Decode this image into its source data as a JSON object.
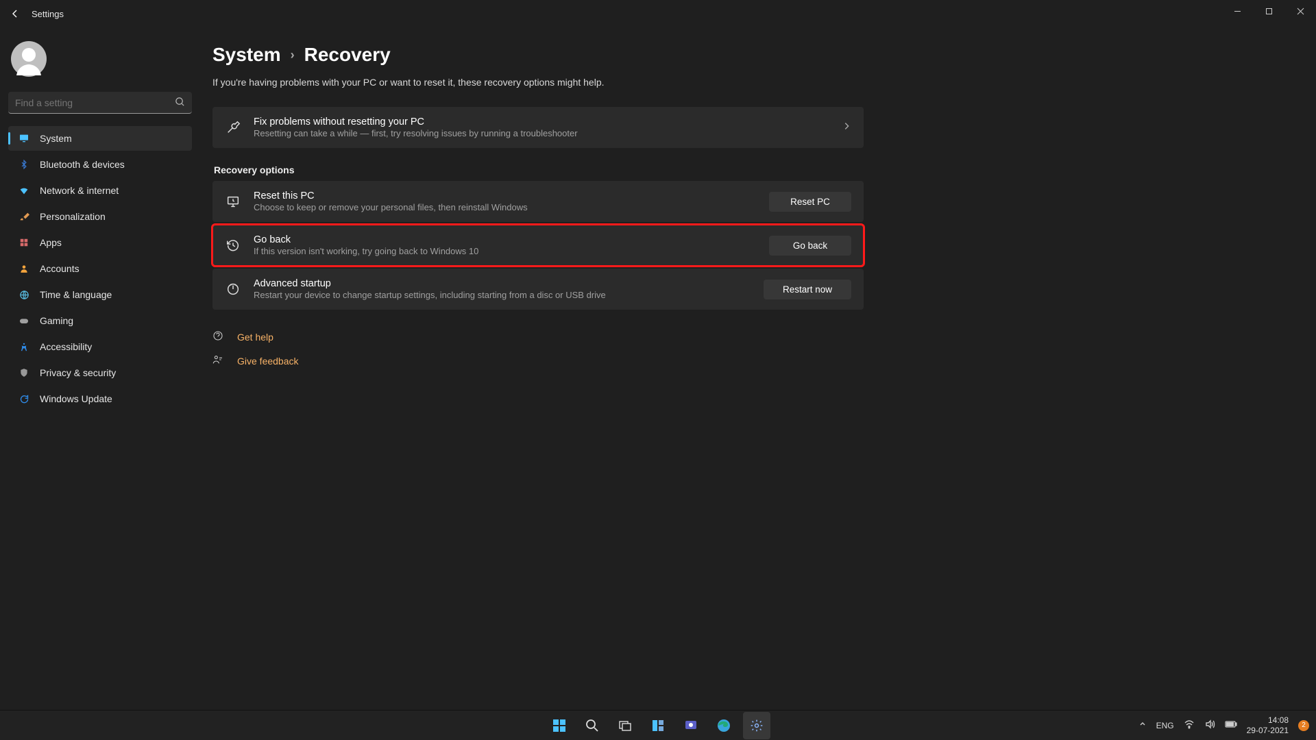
{
  "window": {
    "title": "Settings"
  },
  "search": {
    "placeholder": "Find a setting"
  },
  "sidebar": {
    "items": [
      {
        "label": "System",
        "icon": "monitor-icon",
        "color": "#4cc2ff",
        "active": true
      },
      {
        "label": "Bluetooth & devices",
        "icon": "bluetooth-icon",
        "color": "#3a7bd5"
      },
      {
        "label": "Network & internet",
        "icon": "wifi-icon",
        "color": "#4cc2ff"
      },
      {
        "label": "Personalization",
        "icon": "brush-icon",
        "color": "#e29a52"
      },
      {
        "label": "Apps",
        "icon": "apps-icon",
        "color": "#d86a6a"
      },
      {
        "label": "Accounts",
        "icon": "person-icon",
        "color": "#f2a33c"
      },
      {
        "label": "Time & language",
        "icon": "globe-clock-icon",
        "color": "#58bce0"
      },
      {
        "label": "Gaming",
        "icon": "gamepad-icon",
        "color": "#a0a0a0"
      },
      {
        "label": "Accessibility",
        "icon": "accessibility-icon",
        "color": "#2f8be8"
      },
      {
        "label": "Privacy & security",
        "icon": "shield-icon",
        "color": "#999"
      },
      {
        "label": "Windows Update",
        "icon": "update-icon",
        "color": "#2f8be8"
      }
    ]
  },
  "breadcrumb": {
    "root": "System",
    "page": "Recovery"
  },
  "subtitle": "If you're having problems with your PC or want to reset it, these recovery options might help.",
  "fixcard": {
    "title": "Fix problems without resetting your PC",
    "desc": "Resetting can take a while — first, try resolving issues by running a troubleshooter"
  },
  "section_title": "Recovery options",
  "options": [
    {
      "title": "Reset this PC",
      "desc": "Choose to keep or remove your personal files, then reinstall Windows",
      "button": "Reset PC",
      "icon": "reset-pc-icon"
    },
    {
      "title": "Go back",
      "desc": "If this version isn't working, try going back to Windows 10",
      "button": "Go back",
      "icon": "history-icon",
      "highlight": true
    },
    {
      "title": "Advanced startup",
      "desc": "Restart your device to change startup settings, including starting from a disc or USB drive",
      "button": "Restart now",
      "icon": "advanced-startup-icon"
    }
  ],
  "links": {
    "help": "Get help",
    "feedback": "Give feedback"
  },
  "taskbar": {
    "lang": "ENG",
    "time": "14:08",
    "date": "29-07-2021",
    "notif_count": "2"
  }
}
